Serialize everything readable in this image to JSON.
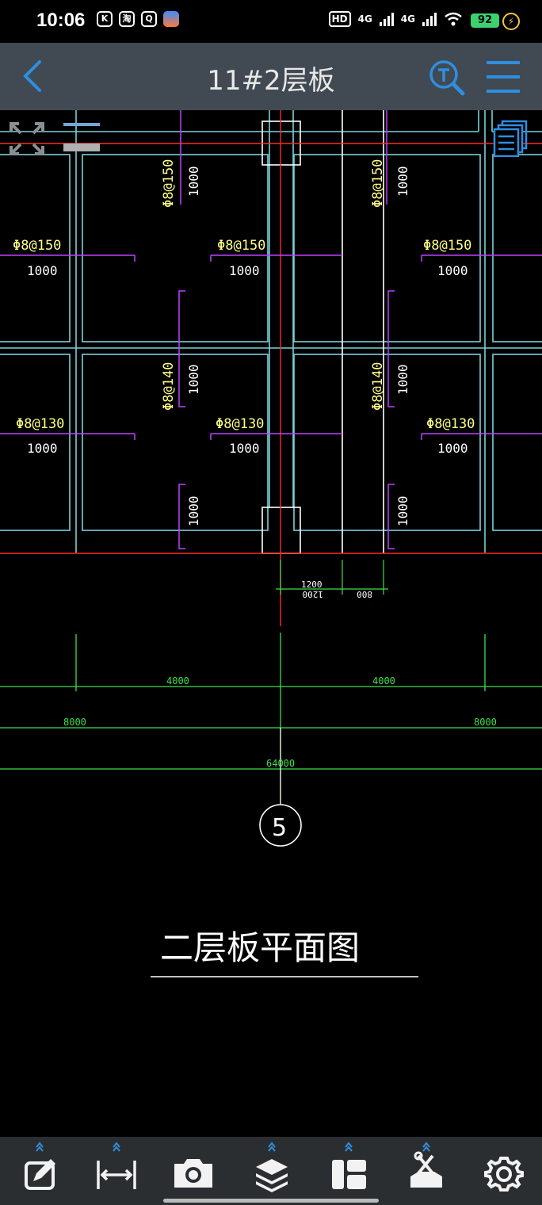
{
  "status_bar": {
    "time": "10:06",
    "app_badges": [
      "K",
      "淘",
      "Q"
    ],
    "hd_label": "HD",
    "network1": "4G",
    "network2": "4G",
    "battery": "92",
    "charging": true
  },
  "header": {
    "title": "11#2层板"
  },
  "drawing": {
    "rebar_labels": [
      "Φ8@150",
      "Φ8@150",
      "Φ8@150",
      "Φ8@150",
      "Φ8@150",
      "Φ8@130",
      "Φ8@130",
      "Φ8@130",
      "Φ8@140",
      "Φ8@140"
    ],
    "lengths": [
      "1000",
      "1000",
      "1000",
      "1000",
      "1000",
      "1000",
      "1000",
      "1000",
      "1000",
      "1000",
      "1000",
      "1000",
      "1000"
    ],
    "dims_small": [
      "1200",
      "1200",
      "800"
    ],
    "dims_row1": [
      "4000",
      "4000"
    ],
    "dims_row2": [
      "8000",
      "8000"
    ],
    "dims_row3": [
      "64000"
    ],
    "axis_label": "5",
    "drawing_title": "二层板平面图"
  },
  "colors": {
    "accent": "#2f8ee0",
    "cad_green": "#3fe04a",
    "cad_yellow": "#ffff8a",
    "cad_magenta": "#c040ff",
    "cad_red": "#ff2a2a",
    "cad_cyan": "#7ad0d8",
    "appbar_bg": "#414a52",
    "toolbar_bg": "#2b2e31"
  }
}
